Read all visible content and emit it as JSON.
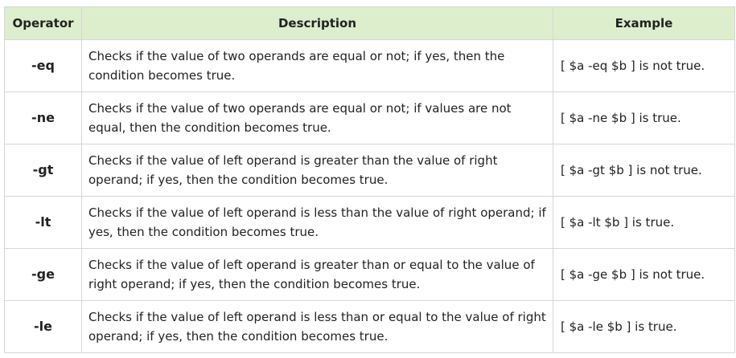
{
  "table": {
    "headers": [
      "Operator",
      "Description",
      "Example"
    ],
    "rows": [
      {
        "operator": "-eq",
        "description": "Checks if the value of two operands are equal or not; if yes, then the condition becomes true.",
        "example": "[ $a -eq $b ] is not true."
      },
      {
        "operator": "-ne",
        "description": "Checks if the value of two operands are equal or not; if values are not equal, then the condition becomes true.",
        "example": "[ $a -ne $b ] is true."
      },
      {
        "operator": "-gt",
        "description": "Checks if the value of left operand is greater than the value of right operand; if yes, then the condition becomes true.",
        "example": "[ $a -gt $b ] is not true."
      },
      {
        "operator": "-lt",
        "description": "Checks if the value of left operand is less than the value of right operand; if yes, then the condition becomes true.",
        "example": "[ $a -lt $b ] is true."
      },
      {
        "operator": "-ge",
        "description": "Checks if the value of left operand is greater than or equal to the value of right operand; if yes, then the condition becomes true.",
        "example": "[ $a -ge $b ] is not true."
      },
      {
        "operator": "-le",
        "description": "Checks if the value of left operand is less than or equal to the value of right operand; if yes, then the condition becomes true.",
        "example": "[ $a -le $b ] is true."
      }
    ]
  },
  "colors": {
    "header_bg": "#ddeecc",
    "border": "#d6d6d6",
    "text": "#222222"
  }
}
